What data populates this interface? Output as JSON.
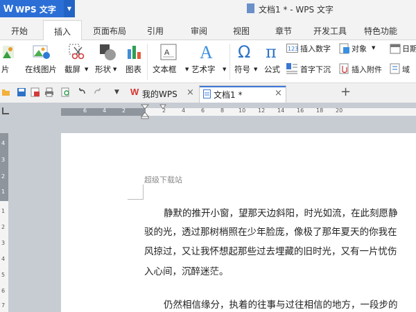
{
  "app": {
    "name": "WPS 文字",
    "logo": "W"
  },
  "window": {
    "title": "文档1 * - WPS 文字"
  },
  "menu_tabs": [
    "开始",
    "插入",
    "页面布局",
    "引用",
    "审阅",
    "视图",
    "章节",
    "开发工具",
    "特色功能"
  ],
  "active_tab": "插入",
  "ribbon": {
    "partial_left": "片",
    "online_picture": "在线图片",
    "screenshot": "截屏",
    "shape": "形状",
    "chart": "图表",
    "textbox": "文本框",
    "wordart": "艺术字",
    "symbol": "符号",
    "formula": "公式",
    "insert_number": "插入数字",
    "object": "对象",
    "date": "日期",
    "dropcap": "首字下沉",
    "attachment": "插入附件",
    "field": "域"
  },
  "doc_tabs": [
    {
      "label": "我的WPS",
      "close": "×"
    },
    {
      "label": "文档1 *",
      "close": "×"
    }
  ],
  "new_tab": "+",
  "ruler": {
    "h_ticks": [
      "6",
      "4",
      "2",
      "2",
      "4",
      "6",
      "8",
      "10",
      "12",
      "14",
      "16",
      "18",
      "20"
    ],
    "v_ticks": [
      "4",
      "3",
      "2",
      "1",
      "1",
      "2",
      "3",
      "4",
      "5",
      "6",
      "7"
    ]
  },
  "document": {
    "header": "超级下载站",
    "lines": [
      "静默的推开小窗，望那天边斜阳，时光如流，在此刻愿静",
      "驳的光，透过那树梢照在少年脸庞，像极了那年夏天的你我在",
      "风掠过，又让我怀想起那些过去埋藏的旧时光，又有一片忧伤",
      "入心间，沉醉迷茫。",
      "仍然相信缘分，执着的往事与过往相信的地方，一段步的"
    ]
  },
  "colors": {
    "brand": "#2b6fd6",
    "active_tab_accent": "#3c78d8",
    "wps_red": "#d9302c"
  }
}
